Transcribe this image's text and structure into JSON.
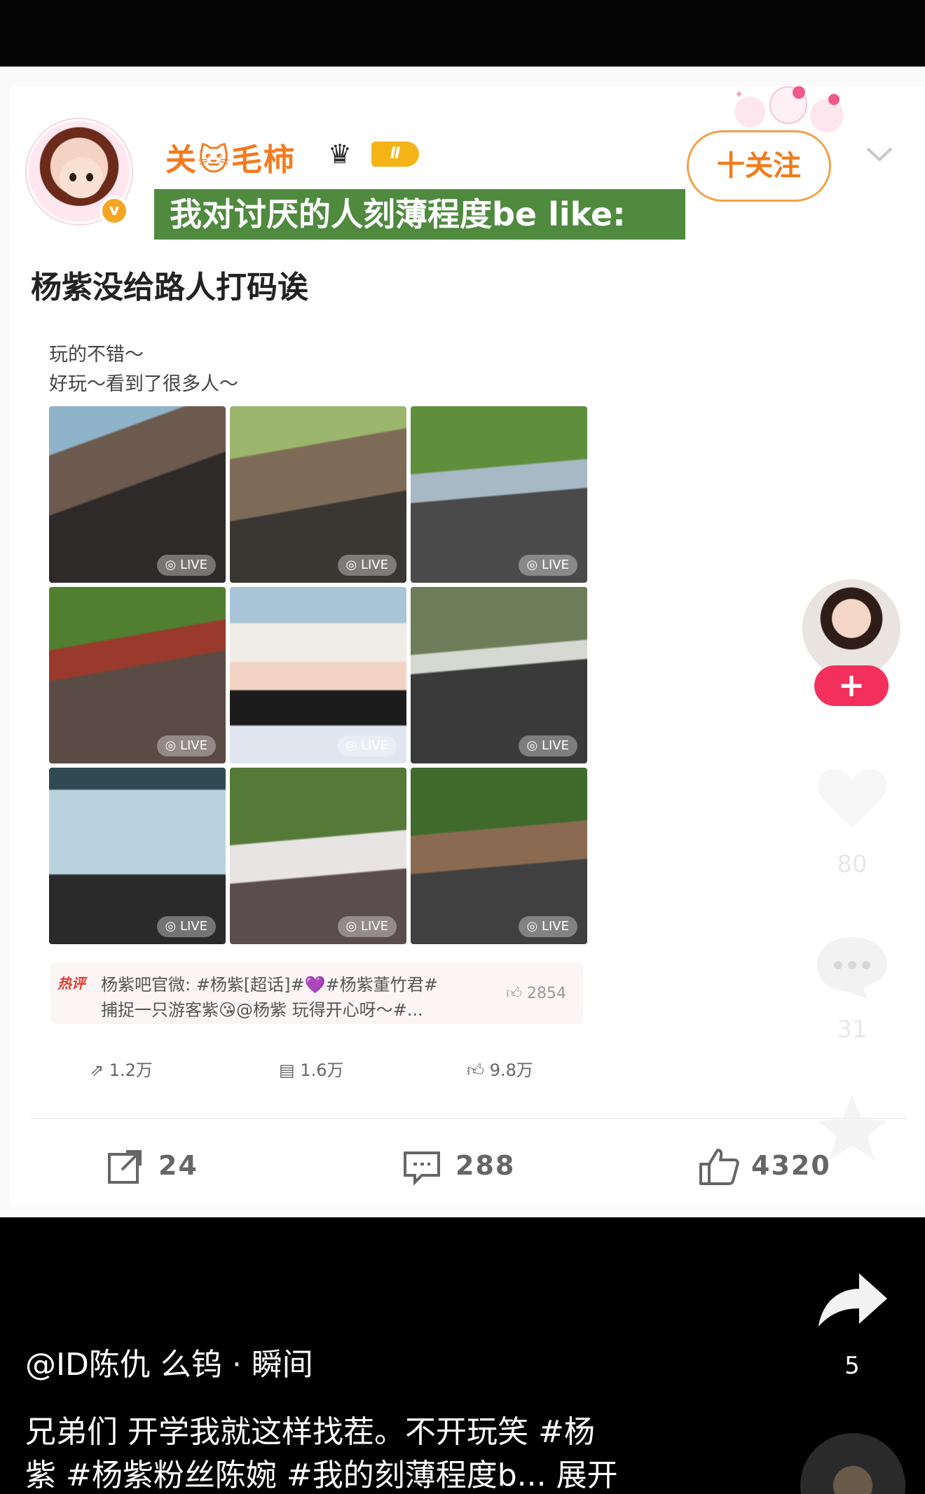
{
  "post": {
    "username": "关🐱毛柿",
    "level_badge": "Ⅱ",
    "verified_mark": "v",
    "tagline": "我对讨厌的人刻薄程度be like:",
    "follow_label": "十关注",
    "title": "杨紫没给路人打码诶",
    "text_line1": "玩的不错～",
    "text_line2": "好玩～看到了很多人～",
    "photos": [
      {
        "live_label": "LIVE"
      },
      {
        "live_label": "LIVE"
      },
      {
        "live_label": "LIVE"
      },
      {
        "live_label": "LIVE"
      },
      {
        "live_label": "LIVE"
      },
      {
        "live_label": "LIVE"
      },
      {
        "live_label": "LIVE"
      },
      {
        "live_label": "LIVE"
      },
      {
        "live_label": "LIVE"
      }
    ],
    "hot_topic": {
      "tag": "热评",
      "line1": "杨紫吧官微: #杨紫[超话]#💜#杨紫董竹君#",
      "line2": "捕捉一只游客紫😘@杨紫 玩得开心呀～#...",
      "likes": "2854"
    },
    "inner_stats": {
      "reposts": "1.2万",
      "comments": "1.6万",
      "likes": "9.8万"
    },
    "actions": {
      "repost_count": "24",
      "comment_count": "288",
      "like_count": "4320"
    }
  },
  "video_rail": {
    "like_count": "80",
    "comment_count": "31",
    "share_count": "5",
    "follow_plus": "+"
  },
  "video_footer": {
    "author": "@ID陈仇 么钨",
    "separator": " · ",
    "time": "瞬间",
    "caption_line1": "兄弟们 开学我就这样找茬。不开玩笑 #杨",
    "caption_line2": "紫 #杨紫粉丝陈婉 #我的刻薄程度b... 展开"
  },
  "colors": {
    "accent_orange": "#f47a1f",
    "tag_green": "#4f8a3f",
    "follow_pink": "#f2305b"
  }
}
